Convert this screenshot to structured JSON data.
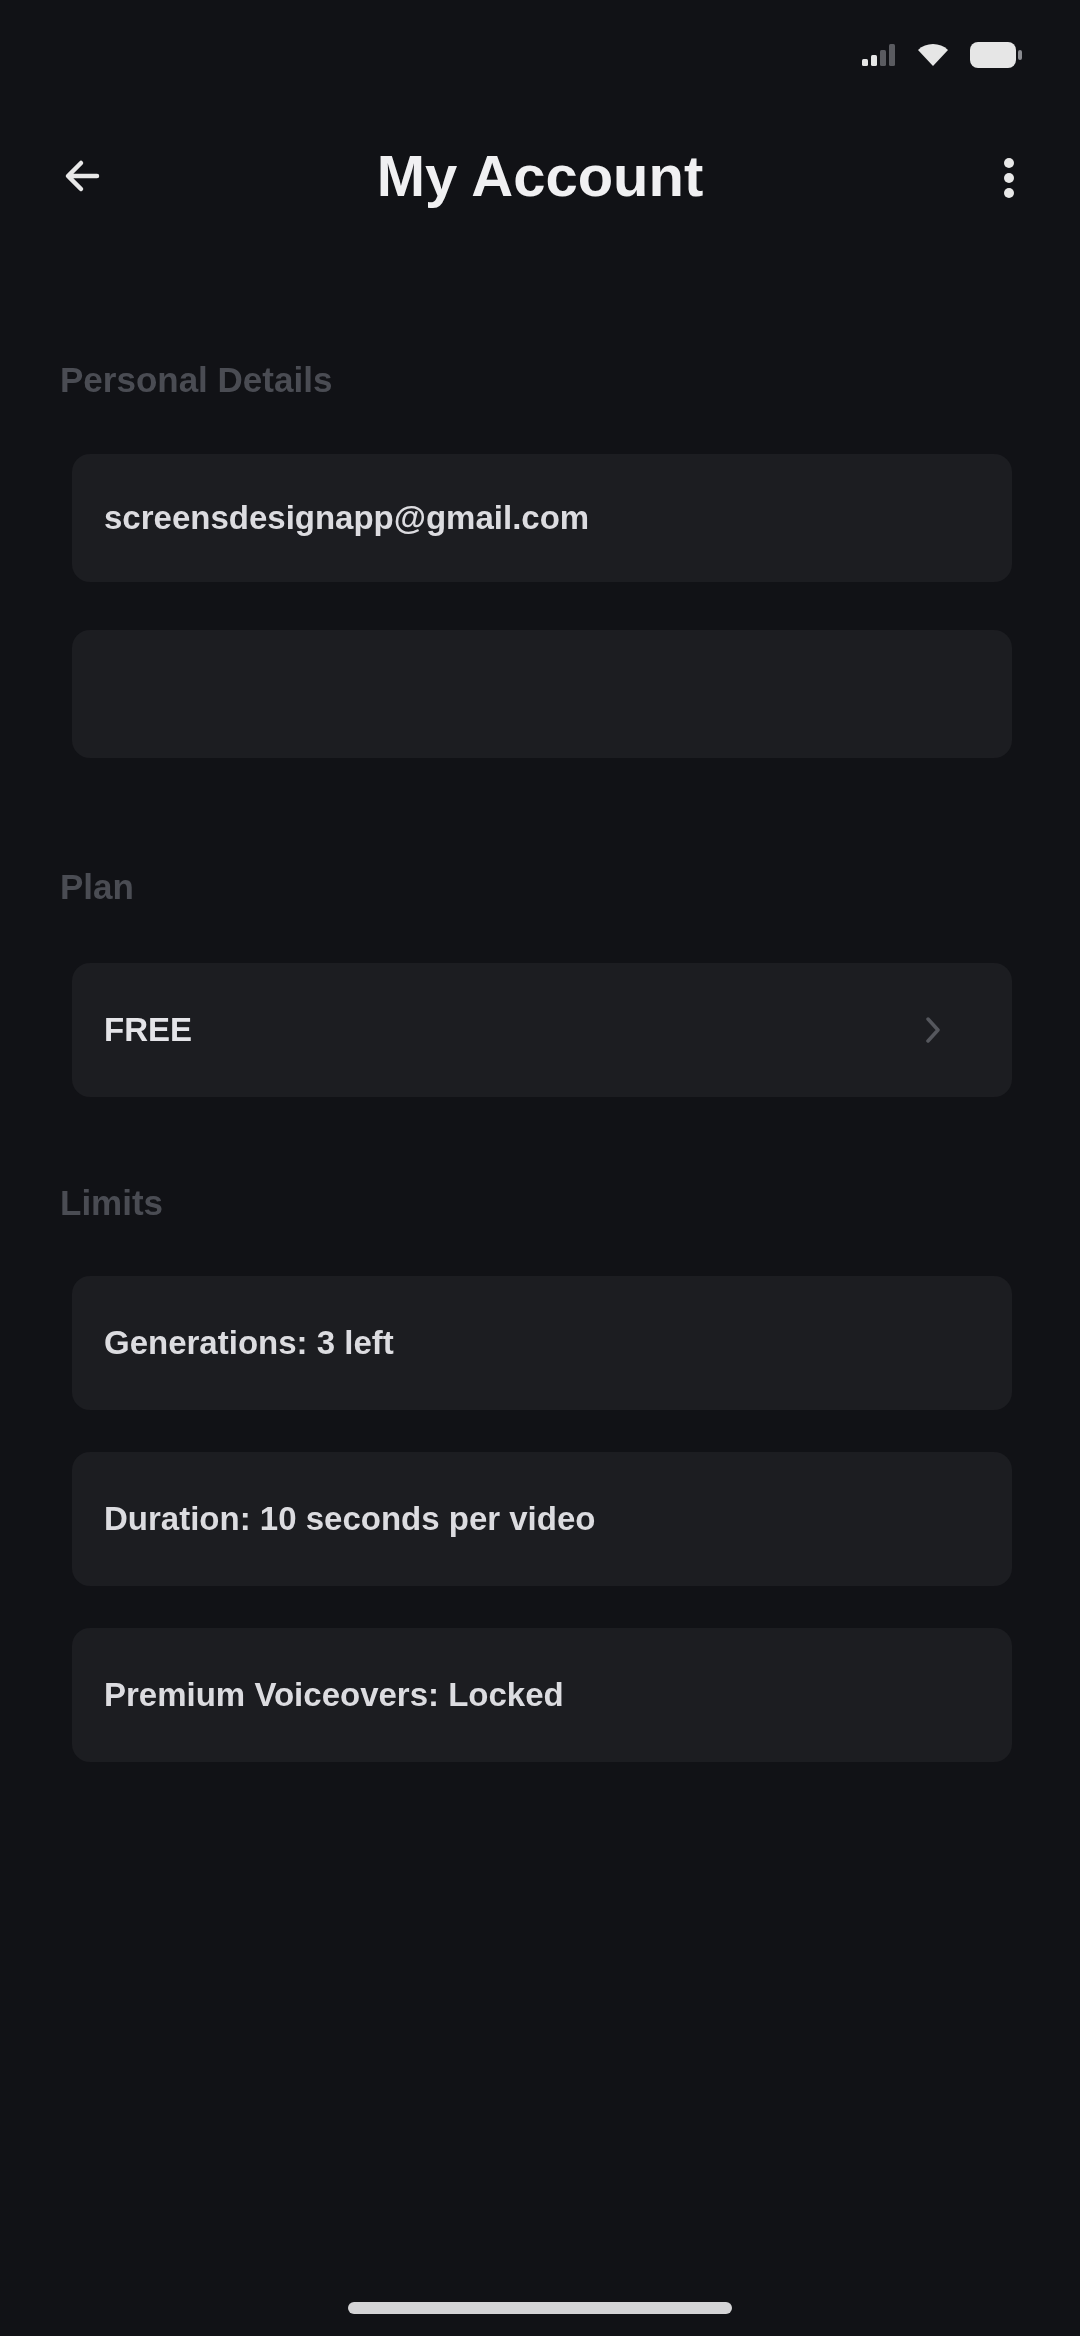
{
  "header": {
    "title": "My Account"
  },
  "personal_details": {
    "label": "Personal Details",
    "fields": [
      {
        "kind": "input",
        "value": "screensdesignapp@gmail.com"
      },
      {
        "kind": "input"
      }
    ]
  },
  "plan": {
    "label": "Plan",
    "value": "FREE"
  },
  "limits": {
    "label": "Limits",
    "items": [
      "Generations: 3 left",
      "Duration: 10 seconds per video",
      "Premium Voiceovers: Locked"
    ]
  }
}
